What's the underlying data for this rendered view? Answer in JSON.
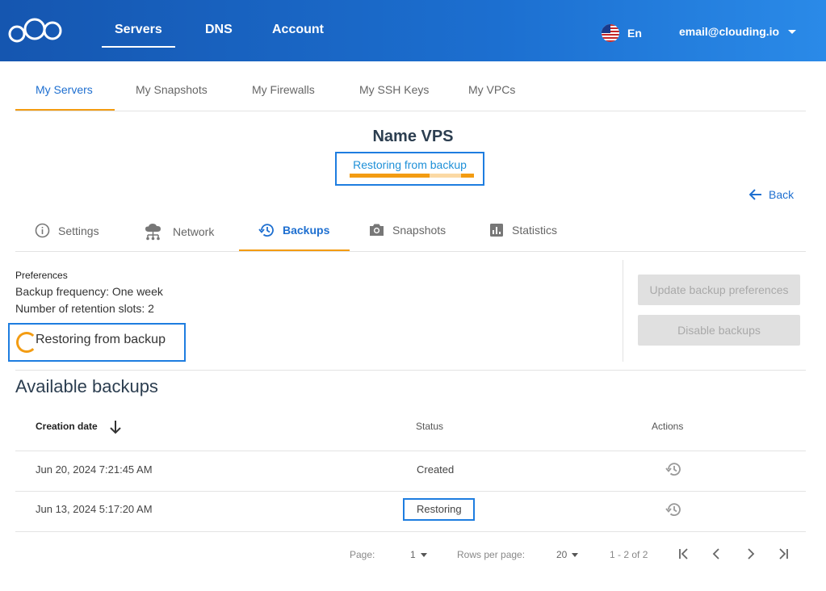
{
  "topnav": {
    "items": [
      "Servers",
      "DNS",
      "Account"
    ],
    "language": "En",
    "email": "email@clouding.io"
  },
  "subtabs": [
    "My Servers",
    "My Snapshots",
    "My Firewalls",
    "My SSH Keys",
    "My VPCs"
  ],
  "server": {
    "name": "Name VPS",
    "status": "Restoring from backup",
    "progress": 0.64,
    "back_label": "Back"
  },
  "server_tabs": [
    "Settings",
    "Network",
    "Backups",
    "Snapshots",
    "Statistics"
  ],
  "preferences": {
    "label": "Preferences",
    "frequency": "Backup frequency: One week",
    "retention": "Number of retention slots: 2",
    "restoring": "Restoring from backup",
    "update_button": "Update backup preferences",
    "disable_button": "Disable backups"
  },
  "backups": {
    "title": "Available backups",
    "columns": [
      "Creation date",
      "Status",
      "Actions"
    ],
    "rows": [
      {
        "date": "Jun 20, 2024 7:21:45 AM",
        "status": "Created"
      },
      {
        "date": "Jun 13, 2024 5:17:20 AM",
        "status": "Restoring"
      }
    ]
  },
  "pagination": {
    "page_label": "Page:",
    "page": "1",
    "rows_label": "Rows per page:",
    "rows_per_page": "20",
    "range": "1 - 2 of 2"
  },
  "colors": {
    "accent": "#1e6fd0",
    "highlight": "#f39c12",
    "header_start": "#1556b0",
    "header_end": "#2a8ae8"
  }
}
